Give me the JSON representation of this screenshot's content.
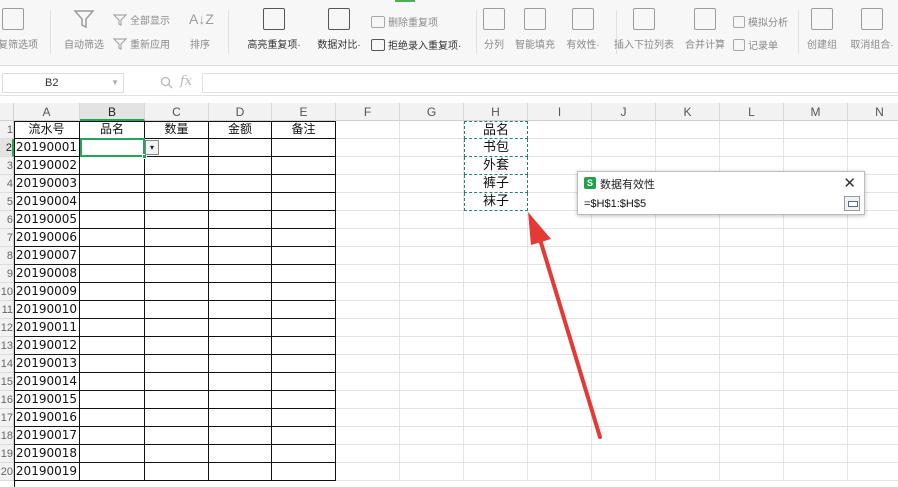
{
  "ribbon": {
    "items": [
      {
        "id": "filter-hidden",
        "label": "重复筛选项"
      },
      {
        "id": "auto-filter",
        "label": "自动筛选"
      },
      {
        "id": "show-all",
        "label": "全部显示"
      },
      {
        "id": "reapply",
        "label": "重新应用"
      },
      {
        "id": "sort",
        "label": "排序"
      },
      {
        "id": "highlight-dup",
        "label": "高亮重复项·"
      },
      {
        "id": "data-compare",
        "label": "数据对比·"
      },
      {
        "id": "delete-dup",
        "label": "删除重复项"
      },
      {
        "id": "reject-dup",
        "label": "拒绝录入重复项·"
      },
      {
        "id": "split",
        "label": "分列"
      },
      {
        "id": "fill",
        "label": "智能填充"
      },
      {
        "id": "validity",
        "label": "有效性·"
      },
      {
        "id": "insert-dropdown",
        "label": "插入下拉列表"
      },
      {
        "id": "consolidate",
        "label": "合并计算"
      },
      {
        "id": "simulate",
        "label": "模拟分析"
      },
      {
        "id": "record",
        "label": "记录单"
      },
      {
        "id": "create-group",
        "label": "创建组"
      },
      {
        "id": "ungroup",
        "label": "取消组合·"
      }
    ]
  },
  "formula_bar": {
    "cell_ref": "B2",
    "fx": "fx",
    "formula": ""
  },
  "columns": [
    "A",
    "B",
    "C",
    "D",
    "E",
    "F",
    "G",
    "H",
    "I",
    "J",
    "K",
    "L",
    "M",
    "N"
  ],
  "rows": [
    "1",
    "2",
    "3",
    "4",
    "5",
    "6",
    "7",
    "8",
    "9",
    "10",
    "11",
    "12",
    "13",
    "14",
    "15",
    "16",
    "17",
    "18",
    "19",
    "20"
  ],
  "table": {
    "headers": [
      "流水号",
      "品名",
      "数量",
      "金额",
      "备注"
    ],
    "serials": [
      "20190001",
      "20190002",
      "20190003",
      "20190004",
      "20190005",
      "20190006",
      "20190007",
      "20190008",
      "20190009",
      "20190010",
      "20190011",
      "20190012",
      "20190013",
      "20190014",
      "20190015",
      "20190016",
      "20190017",
      "20190018",
      "20190019"
    ]
  },
  "source_list": [
    "品名",
    "书包",
    "外套",
    "裤子",
    "袜子"
  ],
  "dropdown_glyph": "▾",
  "dialog": {
    "logo": "S",
    "title": "数据有效性",
    "close": "✕",
    "range": "=$H$1:$H$5"
  },
  "colors": {
    "selection": "#22a559",
    "arrow": "#e53935",
    "marching_ants": "#2f7f6f"
  }
}
